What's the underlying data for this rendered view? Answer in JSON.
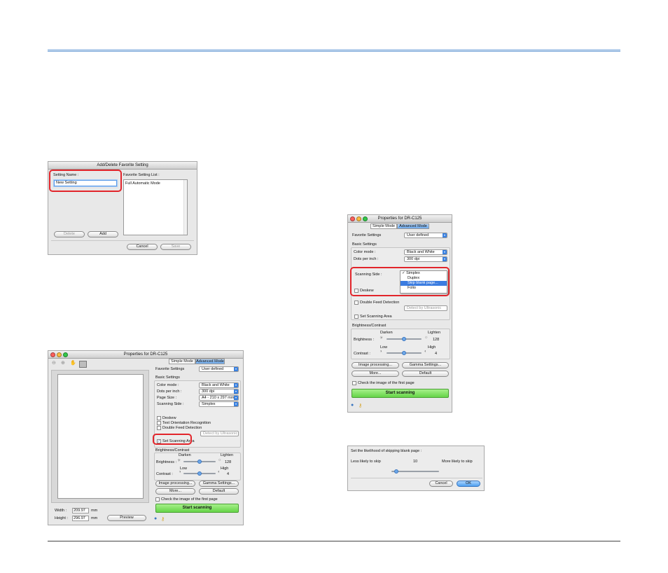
{
  "colors": {
    "header_rule": "#a6c6e8",
    "accent_red": "#e2252b",
    "start_green": "#66d448",
    "selection_blue": "#3b7ce0"
  },
  "fav_dialog": {
    "title": "Add/Delete Favorite Setting",
    "setting_name_label": "Setting Name :",
    "setting_name_value": "New Setting",
    "list_label": "Favorite Setting List :",
    "list_items": [
      "Full Automatic Mode"
    ],
    "delete_label": "Delete",
    "add_label": "Add",
    "cancel_label": "Cancel",
    "save_label": "Save"
  },
  "props_large": {
    "title": "Properties for DR-C125",
    "tabs": [
      "Simple Mode",
      "Advanced Mode"
    ],
    "favorite_label": "Favorite Settings",
    "favorite_value": "User defined",
    "basic_settings": "Basic Settings",
    "rows": [
      {
        "label": "Color mode :",
        "value": "Black and White"
      },
      {
        "label": "Dots per inch :",
        "value": "300 dpi"
      },
      {
        "label": "Page Size :",
        "value": "A4 - 210 x 297 mm"
      },
      {
        "label": "Scanning Side :",
        "value": "Simplex"
      }
    ],
    "checkboxes": [
      "Deskew",
      "Text Orientation Recognition",
      "Double Feed Detection"
    ],
    "detect_value": "Detect by Ultrasonic",
    "set_scanning_area": "Set Scanning Area",
    "brightness_contrast": "Brightness/Contrast",
    "darken": "Darken",
    "lighten": "Lighten",
    "brightness_label": "Brightness :",
    "brightness_value": "128",
    "low": "Low",
    "high": "High",
    "contrast_label": "Contrast :",
    "contrast_value": "4",
    "image_processing": "Image processing...",
    "gamma_settings": "Gamma Settings...",
    "more": "More...",
    "default": "Default",
    "check_first_page": "Check the image of the first page",
    "start_scanning": "Start scanning",
    "width_label": "Width :",
    "width_value": "209.97",
    "width_unit": "mm",
    "height_label": "Height :",
    "height_value": "296.97",
    "height_unit": "mm",
    "preview_label": "Preview"
  },
  "props_small": {
    "title": "Properties for DR-C125",
    "tabs": [
      "Simple Mode",
      "Advanced Mode"
    ],
    "favorite_label": "Favorite Settings",
    "favorite_value": "User defined",
    "basic_settings": "Basic Settings",
    "rows": [
      {
        "label": "Color mode :",
        "value": "Black and White"
      },
      {
        "label": "Dots per inch :",
        "value": "300 dpi"
      }
    ],
    "scanning_side_label": "Scanning Side :",
    "dropdown_items": [
      "✓ Simplex",
      "Duplex",
      "Skip blank page...",
      "Folio"
    ],
    "deskew": "Deskew",
    "double_feed": "Double Feed Detection",
    "detect_value": "Detect by Ultrasonic",
    "set_scanning_area": "Set Scanning Area",
    "brightness_contrast": "Brightness/Contrast",
    "darken": "Darken",
    "lighten": "Lighten",
    "brightness_label": "Brightness :",
    "brightness_value": "128",
    "low": "Low",
    "high": "High",
    "contrast_label": "Contrast :",
    "contrast_value": "4",
    "image_processing": "Image processing...",
    "gamma_settings": "Gamma Settings...",
    "more": "More...",
    "default": "Default",
    "check_first_page": "Check the image of the first page",
    "start_scanning": "Start scanning"
  },
  "skip_dialog": {
    "prompt": "Set the likelihood of skipping blank page :",
    "less_label": "Less likely to skip",
    "value": "10",
    "more_label": "More likely to skip",
    "cancel_label": "Cancel",
    "ok_label": "OK"
  }
}
